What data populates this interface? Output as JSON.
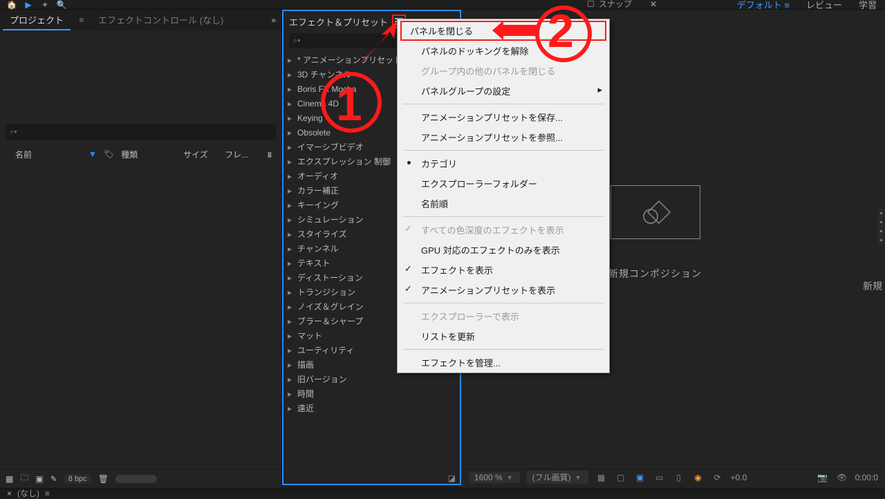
{
  "workspace": {
    "default": "デフォルト",
    "review": "レビュー",
    "learn": "学習",
    "snap": "スナップ"
  },
  "project": {
    "tab_project": "プロジェクト",
    "tab_effect_controls": "エフェクトコントロール  (なし)",
    "columns": {
      "name": "名前",
      "type": "種類",
      "size": "サイズ",
      "more": "フレ..."
    },
    "bpc": "8 bpc"
  },
  "fx_panel": {
    "title": "エフェクト＆プリセット"
  },
  "fx_tree": [
    "* アニメーションプリセット",
    "3D チャンネル",
    "Boris FX Mocha",
    "Cinema 4D",
    "Keying",
    "Obsolete",
    "イマーシブビデオ",
    "エクスプレッション 制御",
    "オーディオ",
    "カラー補正",
    "キーイング",
    "シミュレーション",
    "スタイライズ",
    "チャンネル",
    "テキスト",
    "ディストーション",
    "トランジション",
    "ノイズ＆グレイン",
    "ブラー＆シャープ",
    "マット",
    "ユーティリティ",
    "描画",
    "旧バージョン",
    "時間",
    "遠近"
  ],
  "context_menu": {
    "close_panel": "パネルを閉じる",
    "undock": "パネルのドッキングを解除",
    "close_others": "グループ内の他のパネルを閉じる",
    "group_settings": "パネルグループの設定",
    "save_preset": "アニメーションプリセットを保存...",
    "browse_preset": "アニメーションプリセットを参照...",
    "category": "カテゴリ",
    "explorer_folder": "エクスプローラーフォルダー",
    "name_order": "名前順",
    "all_depth": "すべての色深度のエフェクトを表示",
    "gpu_only": "GPU 対応のエフェクトのみを表示",
    "show_effects": "エフェクトを表示",
    "show_presets": "アニメーションプリセットを表示",
    "show_explorer": "エクスプローラーで表示",
    "refresh": "リストを更新",
    "manage": "エフェクトを管理..."
  },
  "right": {
    "new_comp": "新規コンポジション",
    "new_something": "新規"
  },
  "viewer": {
    "zoom": "1600 %",
    "res": "(フル画質)",
    "exposure": "+0.0",
    "time": "0:00:0"
  },
  "bottom": {
    "none": "(なし)"
  }
}
